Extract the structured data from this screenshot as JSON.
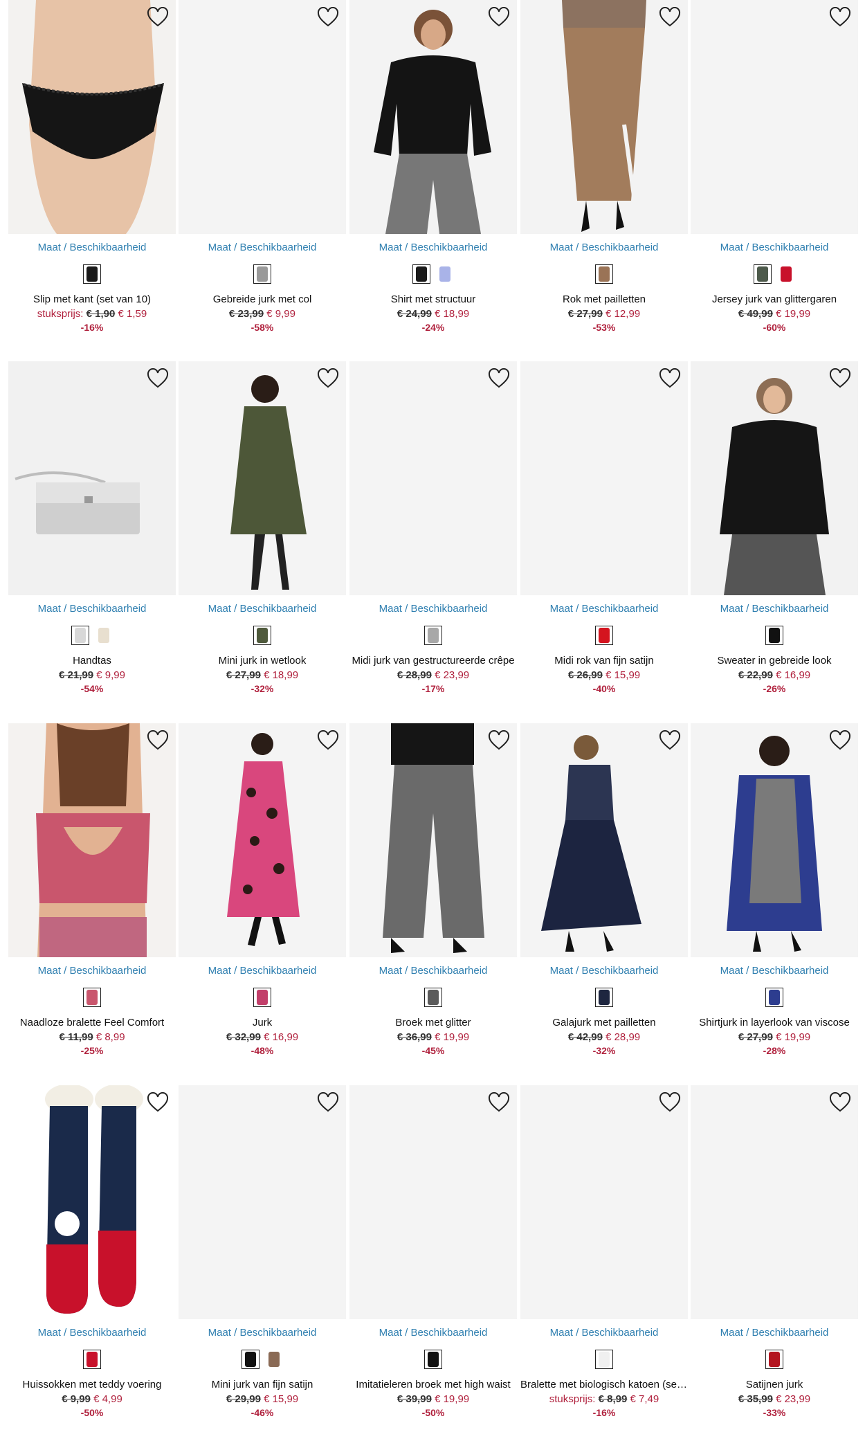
{
  "labels": {
    "size_link": "Maat / Beschikbaarheid"
  },
  "colors": {
    "link": "#2f7fb0",
    "sale": "#b0213d",
    "image_bg": "#f4f4f4"
  },
  "products": [
    {
      "name": "Slip met kant (set van 10)",
      "unit_label": "stuksprijs:",
      "old_price": "€ 1,90",
      "price": "€ 1,59",
      "discount": "-16%",
      "image": "black-lace-briefs",
      "swatches": [
        "#1a1a1a"
      ]
    },
    {
      "name": "Gebreide jurk met col",
      "unit_label": "",
      "old_price": "€ 23,99",
      "price": "€ 9,99",
      "discount": "-58%",
      "image": "",
      "swatches": [
        "#9a9a9a"
      ]
    },
    {
      "name": "Shirt met structuur",
      "unit_label": "",
      "old_price": "€ 24,99",
      "price": "€ 18,99",
      "discount": "-24%",
      "image": "black-sweater-grey-pants",
      "swatches": [
        "#1a1a1a",
        "#a9b3e8"
      ]
    },
    {
      "name": "Rok met pailletten",
      "unit_label": "",
      "old_price": "€ 27,99",
      "price": "€ 12,99",
      "discount": "-53%",
      "image": "sequin-skirt",
      "swatches": [
        "#9a7356"
      ]
    },
    {
      "name": "Jersey jurk van glittergaren",
      "unit_label": "",
      "old_price": "€ 49,99",
      "price": "€ 19,99",
      "discount": "-60%",
      "image": "",
      "swatches": [
        "#4d5a4b",
        "#c8112b"
      ]
    },
    {
      "name": "Handtas",
      "unit_label": "",
      "old_price": "€ 21,99",
      "price": "€ 9,99",
      "discount": "-54%",
      "image": "silver-handbag",
      "swatches": [
        "#d8d8d8",
        "#e8dfcf"
      ]
    },
    {
      "name": "Mini jurk in wetlook",
      "unit_label": "",
      "old_price": "€ 27,99",
      "price": "€ 18,99",
      "discount": "-32%",
      "image": "olive-dress",
      "swatches": [
        "#4f5a3c"
      ]
    },
    {
      "name": "Midi jurk van gestructureerde crêpe",
      "unit_label": "",
      "old_price": "€ 28,99",
      "price": "€ 23,99",
      "discount": "-17%",
      "image": "",
      "swatches": [
        "#a8a8a8"
      ]
    },
    {
      "name": "Midi rok van fijn satijn",
      "unit_label": "",
      "old_price": "€ 26,99",
      "price": "€ 15,99",
      "discount": "-40%",
      "image": "",
      "swatches": [
        "#d4141f"
      ]
    },
    {
      "name": "Sweater in gebreide look",
      "unit_label": "",
      "old_price": "€ 22,99",
      "price": "€ 16,99",
      "discount": "-26%",
      "image": "black-hoodie",
      "swatches": [
        "#111111"
      ]
    },
    {
      "name": "Naadloze bralette Feel Comfort",
      "unit_label": "",
      "old_price": "€ 11,99",
      "price": "€ 8,99",
      "discount": "-25%",
      "image": "pink-bralette",
      "swatches": [
        "#c9566d"
      ]
    },
    {
      "name": "Jurk",
      "unit_label": "",
      "old_price": "€ 32,99",
      "price": "€ 16,99",
      "discount": "-48%",
      "image": "leopard-dress",
      "swatches": [
        "#c23f6a"
      ]
    },
    {
      "name": "Broek met glitter",
      "unit_label": "",
      "old_price": "€ 36,99",
      "price": "€ 19,99",
      "discount": "-45%",
      "image": "glitter-pants",
      "swatches": [
        "#5b5b5b"
      ]
    },
    {
      "name": "Galajurk met pailletten",
      "unit_label": "",
      "old_price": "€ 42,99",
      "price": "€ 28,99",
      "discount": "-32%",
      "image": "navy-gala-dress",
      "swatches": [
        "#1e2640"
      ]
    },
    {
      "name": "Shirtjurk in layerlook van viscose",
      "unit_label": "",
      "old_price": "€ 27,99",
      "price": "€ 19,99",
      "discount": "-28%",
      "image": "blue-cardigan-dress",
      "swatches": [
        "#2d3d8f"
      ]
    },
    {
      "name": "Huissokken met teddy voering",
      "unit_label": "",
      "old_price": "€ 9,99",
      "price": "€ 4,99",
      "discount": "-50%",
      "image": "christmas-socks",
      "swatches": [
        "#c8112b"
      ]
    },
    {
      "name": "Mini jurk van fijn satijn",
      "unit_label": "",
      "old_price": "€ 29,99",
      "price": "€ 15,99",
      "discount": "-46%",
      "image": "",
      "swatches": [
        "#111111",
        "#8a6a55"
      ]
    },
    {
      "name": "Imitatieleren broek met high waist",
      "unit_label": "",
      "old_price": "€ 39,99",
      "price": "€ 19,99",
      "discount": "-50%",
      "image": "",
      "swatches": [
        "#111111"
      ]
    },
    {
      "name": "Bralette met biologisch katoen (set…",
      "unit_label": "stuksprijs:",
      "old_price": "€ 8,99",
      "price": "€ 7,49",
      "discount": "-16%",
      "image": "",
      "swatches": [
        "#f0f0f0"
      ]
    },
    {
      "name": "Satijnen jurk",
      "unit_label": "",
      "old_price": "€ 35,99",
      "price": "€ 23,99",
      "discount": "-33%",
      "image": "",
      "swatches": [
        "#b3141f"
      ]
    }
  ]
}
